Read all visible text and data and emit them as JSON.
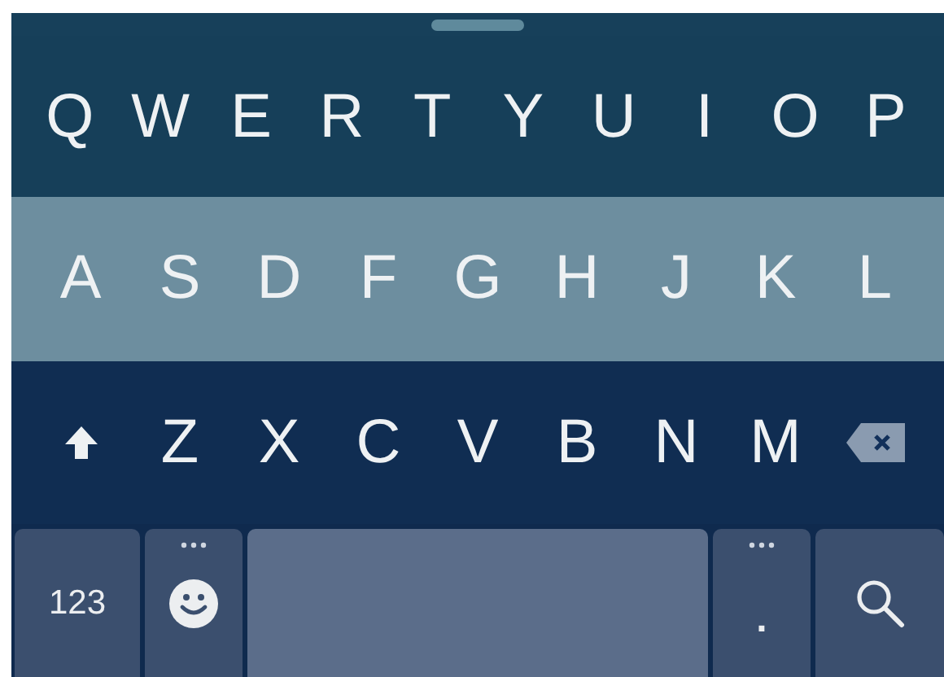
{
  "rows": [
    {
      "keys": [
        {
          "kind": "letter",
          "label": "Q"
        },
        {
          "kind": "letter",
          "label": "W"
        },
        {
          "kind": "letter",
          "label": "E"
        },
        {
          "kind": "letter",
          "label": "R"
        },
        {
          "kind": "letter",
          "label": "T"
        },
        {
          "kind": "letter",
          "label": "Y"
        },
        {
          "kind": "letter",
          "label": "U"
        },
        {
          "kind": "letter",
          "label": "I"
        },
        {
          "kind": "letter",
          "label": "O"
        },
        {
          "kind": "letter",
          "label": "P"
        }
      ]
    },
    {
      "keys": [
        {
          "kind": "letter",
          "label": "A"
        },
        {
          "kind": "letter",
          "label": "S"
        },
        {
          "kind": "letter",
          "label": "D"
        },
        {
          "kind": "letter",
          "label": "F"
        },
        {
          "kind": "letter",
          "label": "G"
        },
        {
          "kind": "letter",
          "label": "H"
        },
        {
          "kind": "letter",
          "label": "J"
        },
        {
          "kind": "letter",
          "label": "K"
        },
        {
          "kind": "letter",
          "label": "L"
        }
      ]
    },
    {
      "keys": [
        {
          "kind": "shift"
        },
        {
          "kind": "letter",
          "label": "Z"
        },
        {
          "kind": "letter",
          "label": "X"
        },
        {
          "kind": "letter",
          "label": "C"
        },
        {
          "kind": "letter",
          "label": "V"
        },
        {
          "kind": "letter",
          "label": "B"
        },
        {
          "kind": "letter",
          "label": "N"
        },
        {
          "kind": "letter",
          "label": "M"
        },
        {
          "kind": "delete"
        }
      ]
    }
  ],
  "bottom_row": [
    {
      "kind": "text",
      "label": "123"
    },
    {
      "kind": "emoji"
    },
    {
      "kind": "space"
    },
    {
      "kind": "period",
      "label": "."
    },
    {
      "kind": "search"
    }
  ]
}
